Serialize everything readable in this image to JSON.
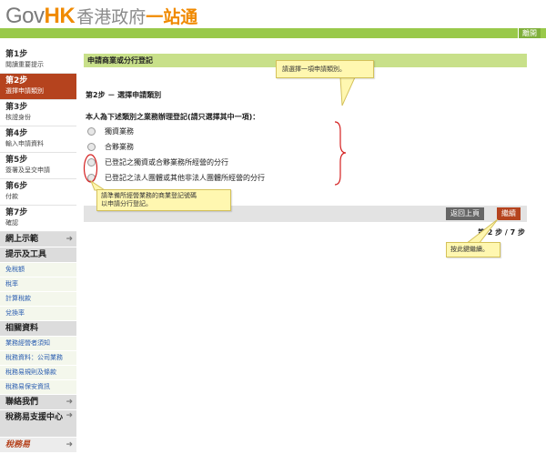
{
  "header": {
    "logo_gov": "Gov",
    "logo_hk": "HK",
    "logo_cn1": "香港政府",
    "logo_cn2": "一站通",
    "exit": "離開"
  },
  "steps": [
    {
      "title": "第1步",
      "sub": "閱讀重要提示"
    },
    {
      "title": "第2步",
      "sub": "選擇申請類別"
    },
    {
      "title": "第3步",
      "sub": "核證身份"
    },
    {
      "title": "第4步",
      "sub": "輸入申請資料"
    },
    {
      "title": "第5步",
      "sub": "簽署及呈交申請"
    },
    {
      "title": "第6步",
      "sub": "付款"
    },
    {
      "title": "第7步",
      "sub": "確認"
    }
  ],
  "sidebar": {
    "demo": "網上示範",
    "tips": "提示及工具",
    "tips_items": [
      "免稅額",
      "稅率",
      "計算稅款",
      "兌換率"
    ],
    "related": "相關資料",
    "related_items": [
      "業務經營者須知",
      "稅務資料：公司業務",
      "稅務易規則及條款",
      "稅務易保安資訊"
    ],
    "contact": "聯絡我們",
    "support": "稅務易支援中心",
    "brand": "稅務易"
  },
  "main": {
    "form_title": "申請商業或分行登記",
    "step_title": "第2步 － 選擇申請類別",
    "question": "本人為下述類別之業務辦理登記(請只選擇其中一項)：",
    "options": [
      "獨資業務",
      "合夥業務",
      "已登記之獨資或合夥業務所經營的分行",
      "已登記之法人團體或其他非法人團體所經營的分行"
    ],
    "back": "返回上頁",
    "next": "繼續",
    "pager": "第 2 步 / 7 步"
  },
  "callouts": {
    "select": "請選擇一項申請類別。",
    "prepare_line1": "請準備所經營業務的商業登記號碼",
    "prepare_line2": "以申請分行登記。",
    "continue": "按此鍵繼續。"
  },
  "colors": {
    "accent_green": "#99c94a",
    "active_step": "#b5431e",
    "logo_orange": "#f08a00",
    "callout_fill": "#fff7b0",
    "annotation_red": "#d42020"
  }
}
